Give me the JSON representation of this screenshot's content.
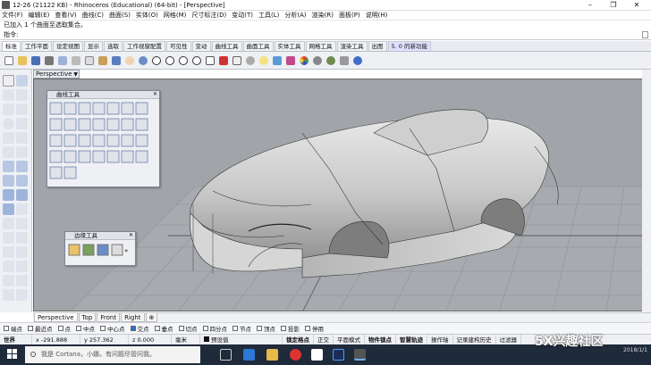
{
  "window": {
    "title": "12-26 (21122 KB) - Rhinoceros (Educational) (64-bit) - [Perspective]",
    "min": "–",
    "max": "❐",
    "close": "✕"
  },
  "menu": [
    "文件(F)",
    "编辑(E)",
    "查看(V)",
    "曲线(C)",
    "曲面(S)",
    "实体(O)",
    "网格(M)",
    "尺寸标注(D)",
    "变动(T)",
    "工具(L)",
    "分析(A)",
    "渲染(R)",
    "面板(P)",
    "说明(H)"
  ],
  "command": {
    "history": "已加入 1 个曲面至选取集合。",
    "prompt": "指令:"
  },
  "toolbar_tabs": [
    "标准",
    "工作平面",
    "设定视图",
    "显示",
    "选取",
    "工作视窗配置",
    "可见性",
    "变动",
    "曲线工具",
    "曲面工具",
    "实体工具",
    "网格工具",
    "渲染工具",
    "出图",
    "5. 0 的新功能"
  ],
  "toolbar_icons": [
    "new-icon",
    "open-icon",
    "save-icon",
    "print-icon",
    "import-icon",
    "cut-icon",
    "copy-icon",
    "paste-icon",
    "undo-icon",
    "pan-icon",
    "rotate-icon",
    "zoom-icon",
    "zoom-window-icon",
    "zoom-extents-icon",
    "zoom-selected-icon",
    "grid-icon",
    "car-icon",
    "select-icon",
    "point-icon",
    "bulb-icon",
    "layer-icon",
    "material-icon",
    "render-icon",
    "sphere-icon",
    "display-icon",
    "options-icon",
    "help-icon"
  ],
  "viewport": {
    "active_tab": "Perspective",
    "tabs": [
      "Perspective",
      "Top",
      "Front",
      "Right"
    ],
    "add_tab": "⊕"
  },
  "curve_tools_panel": {
    "title": "曲线工具"
  },
  "edge_tools_panel": {
    "title": "边缘工具"
  },
  "osnap": [
    {
      "label": "端点",
      "on": false
    },
    {
      "label": "最近点",
      "on": false
    },
    {
      "label": "点",
      "on": false
    },
    {
      "label": "中点",
      "on": false
    },
    {
      "label": "中心点",
      "on": false
    },
    {
      "label": "交点",
      "on": true
    },
    {
      "label": "垂点",
      "on": false
    },
    {
      "label": "切点",
      "on": false
    },
    {
      "label": "四分点",
      "on": false
    },
    {
      "label": "节点",
      "on": false
    },
    {
      "label": "顶点",
      "on": false
    },
    {
      "label": "投影",
      "on": false
    },
    {
      "label": "停用",
      "on": false
    }
  ],
  "status": {
    "cplane": "世界",
    "x": "x -291.888",
    "y": "y 257.362",
    "z": "z 0.000",
    "units": "毫米",
    "layer": "预设值",
    "items": [
      "锁定格点",
      "正交",
      "平面模式",
      "物件锁点",
      "智慧轨迹",
      "操作轴",
      "记录建构历史",
      "过滤器"
    ],
    "bold_items": [
      "锁定格点",
      "物件锁点",
      "智慧轨迹"
    ]
  },
  "taskbar": {
    "search_placeholder": "我是 Cortana，小娜。有问题尽管问我。",
    "date": "2018/1/1"
  },
  "watermark": "5X兴趣社区"
}
